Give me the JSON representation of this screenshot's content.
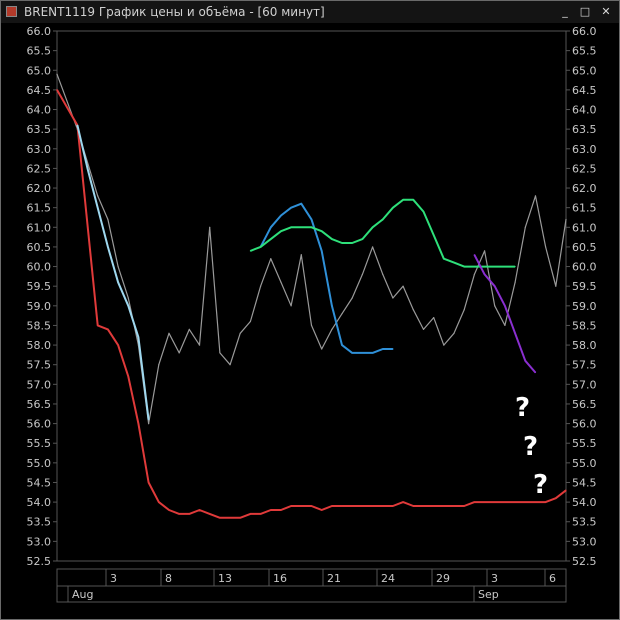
{
  "window": {
    "title": "BRENT1119 График цены и объёма - [60 минут]",
    "icons": {
      "app": "chart-app-icon",
      "minimize": "minimize-icon",
      "maximize": "maximize-icon",
      "close": "close-icon"
    },
    "controls": {
      "minimize": "_",
      "maximize": "□",
      "close": "✕"
    }
  },
  "annotations": [
    "?",
    "?",
    "?"
  ],
  "colors": {
    "background": "#000000",
    "grid": "#555555",
    "price": "#9a9a9a",
    "red": "#e03a3a",
    "light_blue": "#9fd8ef",
    "blue": "#2f90d8",
    "green": "#2ee07a",
    "purple": "#8a2fd0",
    "axis_text": "#c8c8c8",
    "annotation": "#ffffff"
  },
  "chart_data": {
    "type": "line",
    "title": "BRENT1119 График цены и объёма - [60 минут]",
    "xlabel": "",
    "ylabel": "",
    "ylim": [
      52.5,
      66.0
    ],
    "y_ticks": [
      "66.0",
      "65.5",
      "65.0",
      "64.5",
      "64.0",
      "63.5",
      "63.0",
      "62.5",
      "62.0",
      "61.5",
      "61.0",
      "60.5",
      "60.0",
      "59.5",
      "59.0",
      "58.5",
      "58.0",
      "57.5",
      "57.0",
      "56.5",
      "56.0",
      "55.5",
      "55.0",
      "54.5",
      "54.0",
      "53.5",
      "53.0",
      "52.5"
    ],
    "x_date_labels": [
      "3",
      "8",
      "13",
      "16",
      "21",
      "24",
      "29",
      "3",
      "6"
    ],
    "x_date_label_positions_idx": [
      1,
      2,
      3,
      4,
      5,
      6,
      7,
      8,
      9
    ],
    "x_month_labels": [
      "Aug",
      "Sep"
    ],
    "grid": true,
    "series": [
      {
        "color_key": "price",
        "x": [
          0,
          2,
          4,
          5,
          6,
          7,
          8,
          9,
          10,
          11,
          12,
          13,
          14,
          15,
          16,
          17,
          18,
          19,
          20,
          21,
          22,
          23,
          24,
          25,
          26,
          27,
          28,
          29,
          30,
          31,
          32,
          33,
          34,
          35,
          36,
          37,
          38,
          39,
          40,
          41,
          42,
          43,
          44,
          45,
          46,
          47,
          48,
          49,
          50
        ],
        "y": [
          64.9,
          63.5,
          61.8,
          61.2,
          60.0,
          59.2,
          58.0,
          56.0,
          57.5,
          58.3,
          57.8,
          58.4,
          58.0,
          61.0,
          57.8,
          57.5,
          58.3,
          58.6,
          59.5,
          60.2,
          59.6,
          59.0,
          60.3,
          58.5,
          57.9,
          58.4,
          58.8,
          59.2,
          59.8,
          60.5,
          59.8,
          59.2,
          59.5,
          58.9,
          58.4,
          58.7,
          58.0,
          58.3,
          58.9,
          59.8,
          60.4,
          59.0,
          58.5,
          59.6,
          61.0,
          61.8,
          60.5,
          59.5,
          61.2
        ]
      },
      {
        "color_key": "red",
        "x": [
          0,
          2,
          4,
          5,
          6,
          7,
          8,
          9,
          10,
          11,
          12,
          13,
          14,
          15,
          16,
          17,
          18,
          19,
          20,
          21,
          22,
          23,
          24,
          25,
          26,
          27,
          28,
          29,
          30,
          31,
          32,
          33,
          34,
          35,
          36,
          37,
          38,
          39,
          40,
          41,
          42,
          43,
          44,
          45,
          46,
          47,
          48,
          49,
          50
        ],
        "y": [
          64.5,
          63.6,
          58.5,
          58.4,
          58.0,
          57.2,
          56.0,
          54.5,
          54.0,
          53.8,
          53.7,
          53.7,
          53.8,
          53.7,
          53.6,
          53.6,
          53.6,
          53.7,
          53.7,
          53.8,
          53.8,
          53.9,
          53.9,
          53.9,
          53.8,
          53.9,
          53.9,
          53.9,
          53.9,
          53.9,
          53.9,
          53.9,
          54.0,
          53.9,
          53.9,
          53.9,
          53.9,
          53.9,
          53.9,
          54.0,
          54.0,
          54.0,
          54.0,
          54.0,
          54.0,
          54.0,
          54.0,
          54.1,
          54.3
        ]
      },
      {
        "color_key": "light_blue",
        "x": [
          2,
          3,
          4,
          5,
          6,
          7,
          8,
          9
        ],
        "y": [
          63.6,
          62.5,
          61.5,
          60.5,
          59.6,
          59.0,
          58.2,
          56.1
        ]
      },
      {
        "color_key": "blue",
        "x": [
          20,
          21,
          22,
          23,
          24,
          25,
          26,
          27,
          28,
          29,
          30,
          31,
          32,
          33
        ],
        "y": [
          60.5,
          61.0,
          61.3,
          61.5,
          61.6,
          61.2,
          60.4,
          59.0,
          58.0,
          57.8,
          57.8,
          57.8,
          57.9,
          57.9
        ]
      },
      {
        "color_key": "green",
        "x": [
          19,
          20,
          21,
          22,
          23,
          24,
          25,
          26,
          27,
          28,
          29,
          30,
          31,
          32,
          33,
          34,
          35,
          36,
          37,
          38,
          39,
          40,
          41,
          42,
          43,
          44,
          45
        ],
        "y": [
          60.4,
          60.5,
          60.7,
          60.9,
          61.0,
          61.0,
          61.0,
          60.9,
          60.7,
          60.6,
          60.6,
          60.7,
          61.0,
          61.2,
          61.5,
          61.7,
          61.7,
          61.4,
          60.8,
          60.2,
          60.1,
          60.0,
          60.0,
          60.0,
          60.0,
          60.0,
          60.0
        ]
      },
      {
        "color_key": "purple",
        "x": [
          41,
          42,
          43,
          44,
          45,
          46,
          47
        ],
        "y": [
          60.3,
          59.8,
          59.5,
          59.0,
          58.3,
          57.6,
          57.3
        ]
      }
    ]
  }
}
